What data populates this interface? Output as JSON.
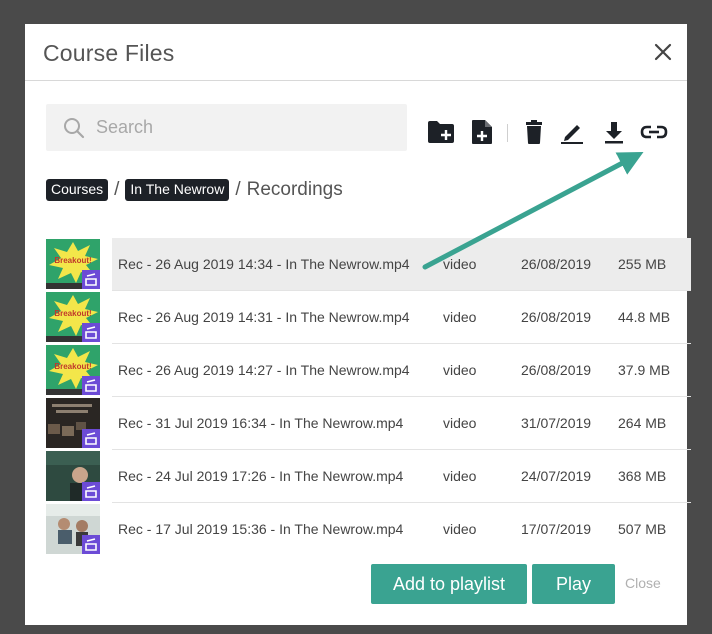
{
  "dialog": {
    "title": "Course Files"
  },
  "search": {
    "placeholder": "Search"
  },
  "breadcrumb": {
    "items": [
      "Courses",
      "In The Newrow"
    ],
    "separator": "/",
    "current": "Recordings"
  },
  "files": [
    {
      "name": "Rec - 26 Aug 2019 14:34 - In The Newrow.mp4",
      "type": "video",
      "date": "26/08/2019",
      "size": "255 MB",
      "thumb": "breakout",
      "thumb_text": "Breakout!",
      "selected": true
    },
    {
      "name": "Rec - 26 Aug 2019 14:31 - In The Newrow.mp4",
      "type": "video",
      "date": "26/08/2019",
      "size": "44.8 MB",
      "thumb": "breakout",
      "thumb_text": "Breakout!",
      "selected": false
    },
    {
      "name": "Rec - 26 Aug 2019 14:27 - In The Newrow.mp4",
      "type": "video",
      "date": "26/08/2019",
      "size": "37.9 MB",
      "thumb": "breakout",
      "thumb_text": "Breakout!",
      "selected": false
    },
    {
      "name": "Rec - 31 Jul 2019 16:34 - In The Newrow.mp4",
      "type": "video",
      "date": "31/07/2019",
      "size": "264 MB",
      "thumb": "dark",
      "selected": false
    },
    {
      "name": "Rec - 24 Jul 2019 17:26 - In The Newrow.mp4",
      "type": "video",
      "date": "24/07/2019",
      "size": "368 MB",
      "thumb": "green",
      "selected": false
    },
    {
      "name": "Rec - 17 Jul 2019 15:36 - In The Newrow.mp4",
      "type": "video",
      "date": "17/07/2019",
      "size": "507 MB",
      "thumb": "office",
      "selected": false
    }
  ],
  "actions": {
    "add_to_playlist": "Add to playlist",
    "play": "Play",
    "close": "Close"
  },
  "toolbar": {
    "icons": [
      "new-folder-icon",
      "new-file-icon",
      "delete-icon",
      "rename-icon",
      "download-icon",
      "link-icon"
    ]
  },
  "colors": {
    "accent": "#3aa391",
    "pill": "#1d2127",
    "badge": "#6c4bd6",
    "annotation_arrow": "#3aa391"
  }
}
